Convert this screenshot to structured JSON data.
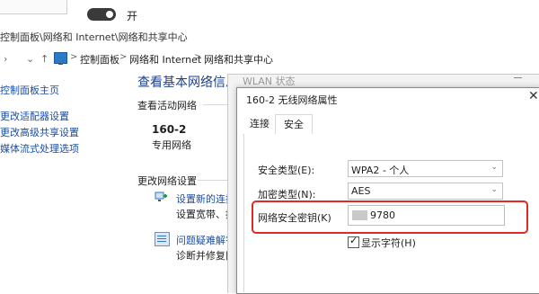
{
  "toggle": {
    "state_label": "开"
  },
  "window": {
    "title": "控制面板\\网络和 Internet\\网络和共享中心"
  },
  "address_bar": {
    "crumbs": [
      "控制面板",
      "网络和 Internet",
      "网络和共享中心"
    ],
    "separator": ">"
  },
  "left_nav": {
    "items": [
      "控制面板主页",
      "更改适配器设置",
      "更改高级共享设置",
      "媒体流式处理选项"
    ]
  },
  "main": {
    "heading": "查看基本网络信息并设置连接",
    "active_networks_label": "查看活动网络",
    "network_name": "160-2",
    "network_type": "专用网络",
    "change_settings_label": "更改网络设置",
    "option1_title": "设置新的连接",
    "option1_desc": "设置宽带、拨",
    "option2_title": "问题疑难解答",
    "option2_desc": "诊断并修复网"
  },
  "background_window": {
    "title": "WLAN 状态"
  },
  "dialog": {
    "title": "160-2 无线网络属性",
    "close_glyph": "✕",
    "tabs": [
      "连接",
      "安全"
    ],
    "active_tab": "安全",
    "security_type_label": "安全类型(E):",
    "security_type_value": "WPA2 - 个人",
    "encryption_type_label": "加密类型(N):",
    "encryption_type_value": "AES",
    "key_label": "网络安全密钥(K)",
    "key_value_visible": "9780",
    "show_chars_label": "显示字符(H)",
    "show_chars_checked": true
  },
  "highlight_color": "#e32626"
}
